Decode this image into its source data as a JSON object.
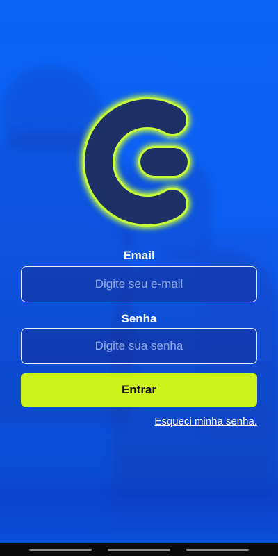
{
  "brand": {
    "logo_color": "#1d3166",
    "logo_glow": "#c8ff3a",
    "icon": "c-logo-icon"
  },
  "colors": {
    "background": "#0b5ef0",
    "button": "#ccf21a",
    "field_border": "#ffffff"
  },
  "form": {
    "email_label": "Email",
    "email_placeholder": "Digite seu e-mail",
    "password_label": "Senha",
    "password_placeholder": "Digite sua senha",
    "submit_label": "Entrar",
    "forgot_label": "Esqueci minha senha."
  }
}
